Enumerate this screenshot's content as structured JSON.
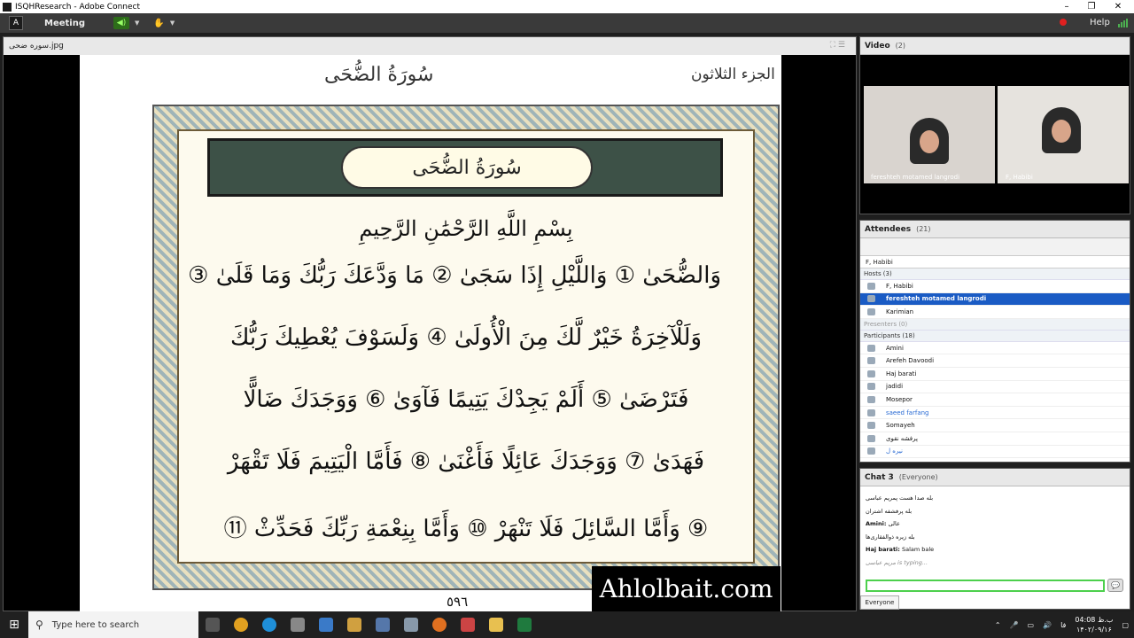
{
  "window": {
    "title": "ISQHResearch - Adobe Connect",
    "controls": [
      "–",
      "❐",
      "✕"
    ]
  },
  "menubar": {
    "logo": "A",
    "meeting": "Meeting",
    "help": "Help"
  },
  "share": {
    "filename": "سوره ضحی.jpg",
    "juz_header": "الجزء الثلاثون",
    "surah_top": "سُورَةُ الضُّحَى",
    "surah_title": "سُورَةُ الضُّحَى",
    "basmala": "بِسْمِ اللَّهِ الرَّحْمَٰنِ الرَّحِيمِ",
    "ayat": [
      "وَالضُّحَىٰ ① وَاللَّيْلِ إِذَا سَجَىٰ ② مَا وَدَّعَكَ رَبُّكَ وَمَا قَلَىٰ ③",
      "وَلَلْآخِرَةُ خَيْرٌ لَّكَ مِنَ الْأُولَىٰ ④ وَلَسَوْفَ يُعْطِيكَ رَبُّكَ",
      "فَتَرْضَىٰ ⑤ أَلَمْ يَجِدْكَ يَتِيمًا فَآوَىٰ ⑥ وَوَجَدَكَ ضَالًّا",
      "فَهَدَىٰ ⑦ وَوَجَدَكَ عَائِلًا فَأَغْنَىٰ ⑧ فَأَمَّا الْيَتِيمَ فَلَا تَقْهَرْ",
      "⑨ وَأَمَّا السَّائِلَ فَلَا تَنْهَرْ ⑩ وَأَمَّا بِنِعْمَةِ رَبِّكَ فَحَدِّثْ ⑪"
    ],
    "page_number": "٥٩٦",
    "watermark": "Ahlolbait.com"
  },
  "video": {
    "title": "Video",
    "count": "(2)",
    "tiles": [
      {
        "name": "fereshteh motamed langrodi"
      },
      {
        "name": "F, Habibi"
      }
    ]
  },
  "attendees": {
    "title": "Attendees",
    "count": "(21)",
    "selected_user": "F, Habibi",
    "hosts_label": "Hosts (3)",
    "hosts": [
      "F, Habibi",
      "fereshteh motamed langrodi",
      "Karimian"
    ],
    "presenters_label": "Presenters (0)",
    "participants_label": "Participants (18)",
    "participants": [
      "Amini",
      "Arefeh Davoodi",
      "Haj barati",
      "jadidi",
      "Mosepor",
      "saeed farfang",
      "Somayeh",
      "پرفشه نقوی",
      "نیره ل"
    ]
  },
  "chat": {
    "title": "Chat 3",
    "scope": "(Everyone)",
    "messages": [
      {
        "text": "بله صدا هست پمریم عباسی"
      },
      {
        "text": "بله پرفشفه اشتران"
      },
      {
        "author": "Amini:",
        "text": "عالی"
      },
      {
        "text": "بله زیره ذوالفقاری‌ها"
      },
      {
        "author": "Haj barati:",
        "text": "Salam bale"
      }
    ],
    "typing": "مریم عباسی is typing...",
    "tab": "Everyone",
    "send_icon": "chat-bubble-icon"
  },
  "taskbar": {
    "search_placeholder": "Type here to search",
    "time": "04:08 ب.ظ",
    "date": "۱۴۰۲/۰۹/۱۶",
    "lang": "فا"
  }
}
